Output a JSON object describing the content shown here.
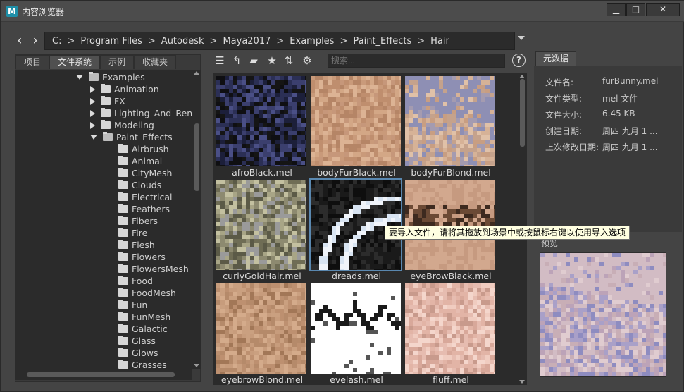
{
  "window": {
    "title": "内容浏览器",
    "app_icon_letter": "M",
    "min_glyph": "▁",
    "max_glyph": "□",
    "close_glyph": "✕"
  },
  "path": {
    "back_glyph": "‹",
    "forward_glyph": "›",
    "separator": ">",
    "segments": [
      "C:",
      "Program Files",
      "Autodesk",
      "Maya2017",
      "Examples",
      "Paint_Effects",
      "Hair"
    ]
  },
  "left_tabs": [
    "项目",
    "文件系统",
    "示例",
    "收藏夹"
  ],
  "left_active_tab": 1,
  "tree": [
    {
      "label": "Examples",
      "depth": 0,
      "state": "open",
      "folder": "open"
    },
    {
      "label": "Animation",
      "depth": 1,
      "state": "closed"
    },
    {
      "label": "FX",
      "depth": 1,
      "state": "closed"
    },
    {
      "label": "Lighting_And_Rend",
      "depth": 1,
      "state": "closed"
    },
    {
      "label": "Modeling",
      "depth": 1,
      "state": "closed"
    },
    {
      "label": "Paint_Effects",
      "depth": 1,
      "state": "open",
      "folder": "open"
    },
    {
      "label": "Airbrush",
      "depth": 2,
      "state": "none"
    },
    {
      "label": "Animal",
      "depth": 2,
      "state": "none"
    },
    {
      "label": "CityMesh",
      "depth": 2,
      "state": "none"
    },
    {
      "label": "Clouds",
      "depth": 2,
      "state": "none"
    },
    {
      "label": "Electrical",
      "depth": 2,
      "state": "none"
    },
    {
      "label": "Feathers",
      "depth": 2,
      "state": "none"
    },
    {
      "label": "Fibers",
      "depth": 2,
      "state": "none"
    },
    {
      "label": "Fire",
      "depth": 2,
      "state": "none"
    },
    {
      "label": "Flesh",
      "depth": 2,
      "state": "none"
    },
    {
      "label": "Flowers",
      "depth": 2,
      "state": "none"
    },
    {
      "label": "FlowersMesh",
      "depth": 2,
      "state": "none"
    },
    {
      "label": "Food",
      "depth": 2,
      "state": "none"
    },
    {
      "label": "FoodMesh",
      "depth": 2,
      "state": "none"
    },
    {
      "label": "Fun",
      "depth": 2,
      "state": "none"
    },
    {
      "label": "FunMesh",
      "depth": 2,
      "state": "none"
    },
    {
      "label": "Galactic",
      "depth": 2,
      "state": "none"
    },
    {
      "label": "Glass",
      "depth": 2,
      "state": "none"
    },
    {
      "label": "Glows",
      "depth": 2,
      "state": "none"
    },
    {
      "label": "Grasses",
      "depth": 2,
      "state": "none"
    }
  ],
  "toolbar": {
    "search_placeholder": "搜索...",
    "help_glyph": "?",
    "icons": [
      "list-view-icon",
      "parent-folder-icon",
      "new-folder-icon",
      "favorite-star-icon",
      "sort-icon",
      "settings-gear-icon"
    ],
    "icon_glyphs": [
      "☰",
      "↰",
      "▰",
      "★",
      "⇅",
      "⚙"
    ]
  },
  "files": [
    {
      "name": "afroBlack.mel",
      "swatch": "afro"
    },
    {
      "name": "bodyFurBlack.mel",
      "swatch": "skin"
    },
    {
      "name": "bodyFurBlond.mel",
      "swatch": "blond"
    },
    {
      "name": "curlyGoldHair.mel",
      "swatch": "curly"
    },
    {
      "name": "dreads.mel",
      "swatch": "dreads",
      "selected": true
    },
    {
      "name": "eyeBrowBlack.mel",
      "swatch": "brow"
    },
    {
      "name": "eyebrowBlond.mel",
      "swatch": "browblond"
    },
    {
      "name": "evelash.mel",
      "swatch": "lash"
    },
    {
      "name": "fluff.mel",
      "swatch": "fluff"
    }
  ],
  "metadata": {
    "tab": "元数据",
    "rows": [
      {
        "label": "文件名:",
        "value": "furBunny.mel"
      },
      {
        "label": "文件类型:",
        "value": "mel 文件"
      },
      {
        "label": "文件大小:",
        "value": "6.45 KB"
      },
      {
        "label": "创建日期:",
        "value": "周四 九月 1 ..."
      },
      {
        "label": "上次修改日期:",
        "value": "周四 九月 1 ..."
      }
    ],
    "preview_label": "预览"
  },
  "tooltip": "要导入文件，请将其拖放到场景中或按鼠标右键以使用导入选项"
}
